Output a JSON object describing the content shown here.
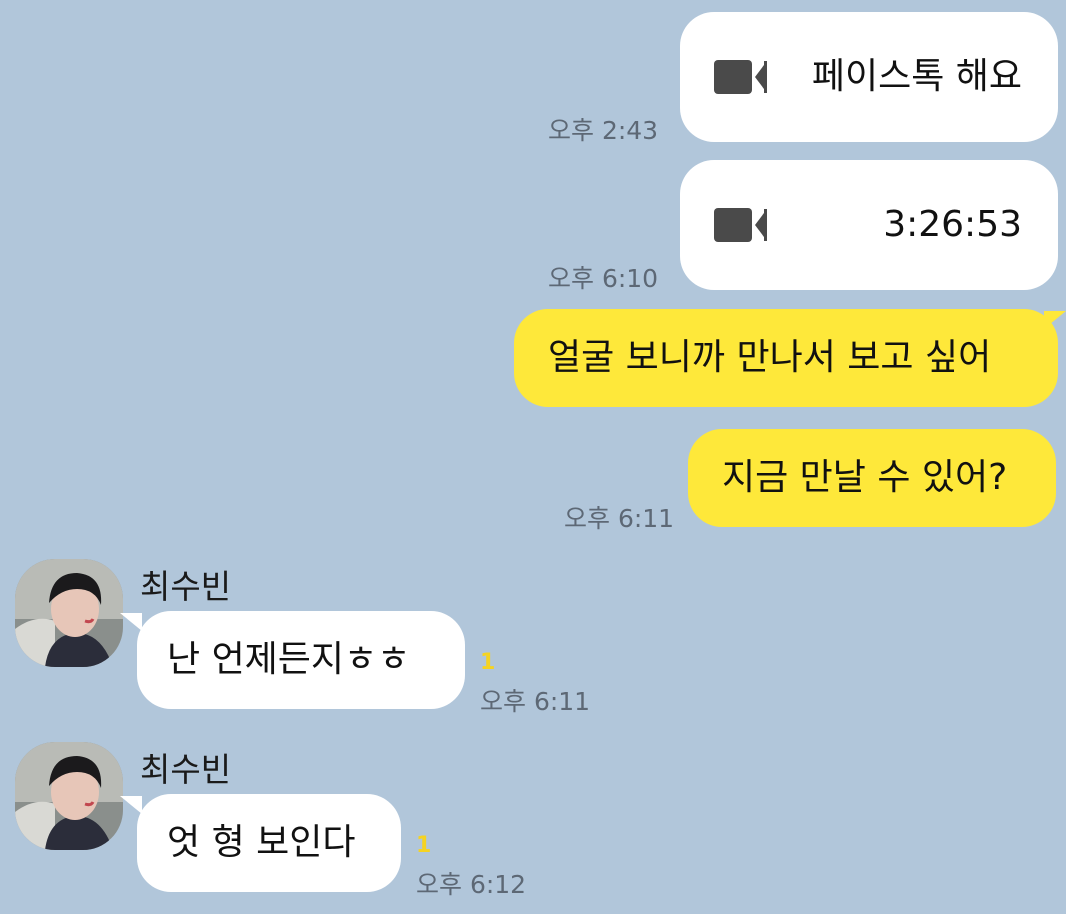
{
  "messages": [
    {
      "id": "m1",
      "type": "video-call",
      "direction": "out",
      "text": "페이스톡 해요",
      "time": "오후 2:43"
    },
    {
      "id": "m2",
      "type": "video-call",
      "direction": "out",
      "text": "3:26:53",
      "time": "오후 6:10"
    },
    {
      "id": "m3",
      "type": "text",
      "direction": "out",
      "text": "얼굴 보니까 만나서 보고 싶어",
      "time": ""
    },
    {
      "id": "m4",
      "type": "text",
      "direction": "out",
      "text": "지금 만날 수 있어?",
      "time": "오후 6:11"
    },
    {
      "id": "m5",
      "type": "text",
      "direction": "in",
      "sender": "최수빈",
      "text": "난 언제든지ㅎㅎ",
      "unread": "1",
      "time": "오후 6:11"
    },
    {
      "id": "m6",
      "type": "text",
      "direction": "in",
      "sender": "최수빈",
      "text": "엇 형 보인다",
      "unread": "1",
      "time": "오후 6:12"
    }
  ],
  "icons": {
    "call": "video-camera-icon",
    "avatar": "profile-photo"
  },
  "colors": {
    "background": "#b1c6da",
    "outgoing_bubble": "#fee83a",
    "incoming_bubble": "#ffffff",
    "unread_count": "#f5d322",
    "timestamp": "#5d6875"
  }
}
